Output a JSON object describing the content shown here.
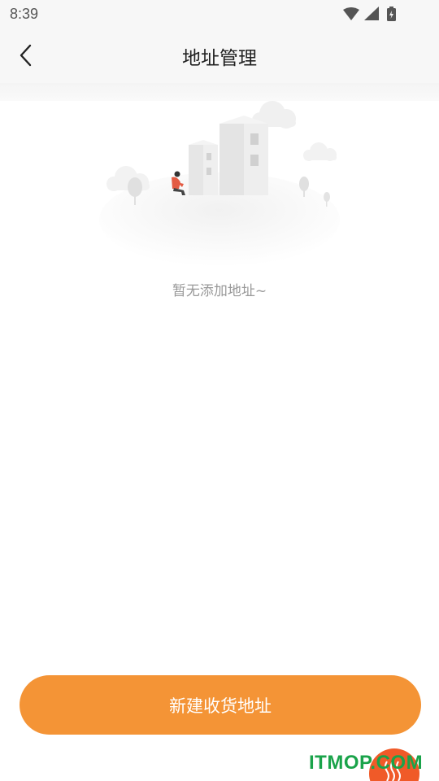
{
  "status_bar": {
    "time": "8:39",
    "icons": [
      "wifi-icon",
      "signal-icon",
      "battery-charging-icon"
    ]
  },
  "nav": {
    "title": "地址管理",
    "back_icon": "chevron-left-icon"
  },
  "empty_state": {
    "illustration": "empty-buildings-illustration",
    "message": "暂无添加地址~"
  },
  "actions": {
    "new_address_label": "新建收货地址"
  },
  "colors": {
    "accent": "#f49436",
    "header_bg": "#f7f7f7",
    "empty_text": "#999999"
  },
  "watermark": {
    "text": "ITMOP.COM"
  }
}
